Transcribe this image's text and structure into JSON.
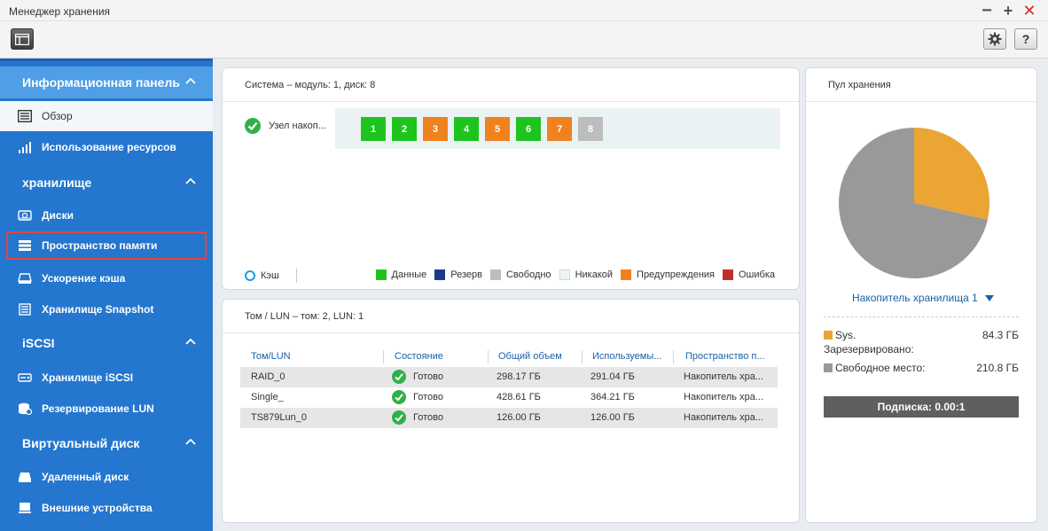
{
  "window": {
    "title": "Менеджер хранения",
    "controls": [
      "minimize-icon",
      "maximize-icon",
      "close-icon"
    ]
  },
  "toolbar": {
    "help_label": "?"
  },
  "sidebar": {
    "sections": [
      {
        "label": "Информационная панель",
        "items": [
          {
            "label": "Обзор",
            "icon": "overview-icon",
            "state": "selected"
          },
          {
            "label": "Использование ресурсов",
            "icon": "resource-chart-icon"
          }
        ]
      },
      {
        "label": "хранилище",
        "items": [
          {
            "label": "Диски",
            "icon": "disk-icon"
          },
          {
            "label": "Пространство памяти",
            "icon": "storage-space-icon",
            "state": "highlighted"
          },
          {
            "label": "Ускорение кэша",
            "icon": "cache-icon"
          },
          {
            "label": "Хранилище Snapshot",
            "icon": "snapshot-icon"
          }
        ]
      },
      {
        "label": "iSCSI",
        "items": [
          {
            "label": "Хранилище iSCSI",
            "icon": "iscsi-icon"
          },
          {
            "label": "Резервирование LUN",
            "icon": "lun-backup-icon"
          }
        ]
      },
      {
        "label": "Виртуальный диск",
        "items": [
          {
            "label": "Удаленный диск",
            "icon": "remote-disk-icon"
          },
          {
            "label": "Внешние устройства",
            "icon": "external-device-icon"
          }
        ]
      }
    ]
  },
  "system_panel": {
    "title": "Система – модуль: 1, диск: 8",
    "node_label": "Узел накоп...",
    "bays": [
      {
        "label": "1",
        "status": "data"
      },
      {
        "label": "2",
        "status": "data"
      },
      {
        "label": "3",
        "status": "warning"
      },
      {
        "label": "4",
        "status": "data"
      },
      {
        "label": "5",
        "status": "warning"
      },
      {
        "label": "6",
        "status": "data"
      },
      {
        "label": "7",
        "status": "warning"
      },
      {
        "label": "8",
        "status": "free"
      }
    ],
    "cache_label": "Кэш",
    "legend": [
      {
        "label": "Данные",
        "color": "#1ec41e"
      },
      {
        "label": "Резерв",
        "color": "#1a3b8c"
      },
      {
        "label": "Свободно",
        "color": "#bdbdbd"
      },
      {
        "label": "Никакой",
        "color": "#eef4f4"
      },
      {
        "label": "Предупреждения",
        "color": "#f0821e"
      },
      {
        "label": "Ошибка",
        "color": "#c0302a"
      }
    ],
    "colors": {
      "data": "#1ec41e",
      "warning": "#f0821e",
      "free": "#bdbdbd"
    }
  },
  "volume_panel": {
    "title": "Том / LUN – том: 2, LUN: 1",
    "columns": [
      "Том/LUN",
      "Состояние",
      "Общий объем",
      "Используемы...",
      "Пространство п..."
    ],
    "rows": [
      {
        "name": "RAID_0",
        "status": "Готово",
        "total": "298.17 ГБ",
        "used": "291.04 ГБ",
        "pool": "Накопитель хра..."
      },
      {
        "name": "Single_",
        "status": "Готово",
        "total": "428.61 ГБ",
        "used": "364.21 ГБ",
        "pool": "Накопитель хра..."
      },
      {
        "name": "TS879Lun_0",
        "status": "Готово",
        "total": "126.00 ГБ",
        "used": "126.00 ГБ",
        "pool": "Накопитель хра..."
      }
    ]
  },
  "pool_panel": {
    "title": "Пул хранения",
    "selected_pool": "Накопитель хранилища 1",
    "lines": [
      {
        "label": "Sys.",
        "value": "84.3 ГБ",
        "color": "#eaa534"
      },
      {
        "label": "Зарезервировано:",
        "value": ""
      },
      {
        "label": "Свободное место:",
        "value": "210.8 ГБ",
        "color": "#999999"
      }
    ],
    "subscription": "Подписка: 0.00:1"
  },
  "chart_data": {
    "type": "pie",
    "slices": [
      {
        "label": "Sys.",
        "value": 84.3,
        "color": "#eaa534"
      },
      {
        "label": "Свободное место",
        "value": 210.8,
        "color": "#999999"
      }
    ]
  }
}
